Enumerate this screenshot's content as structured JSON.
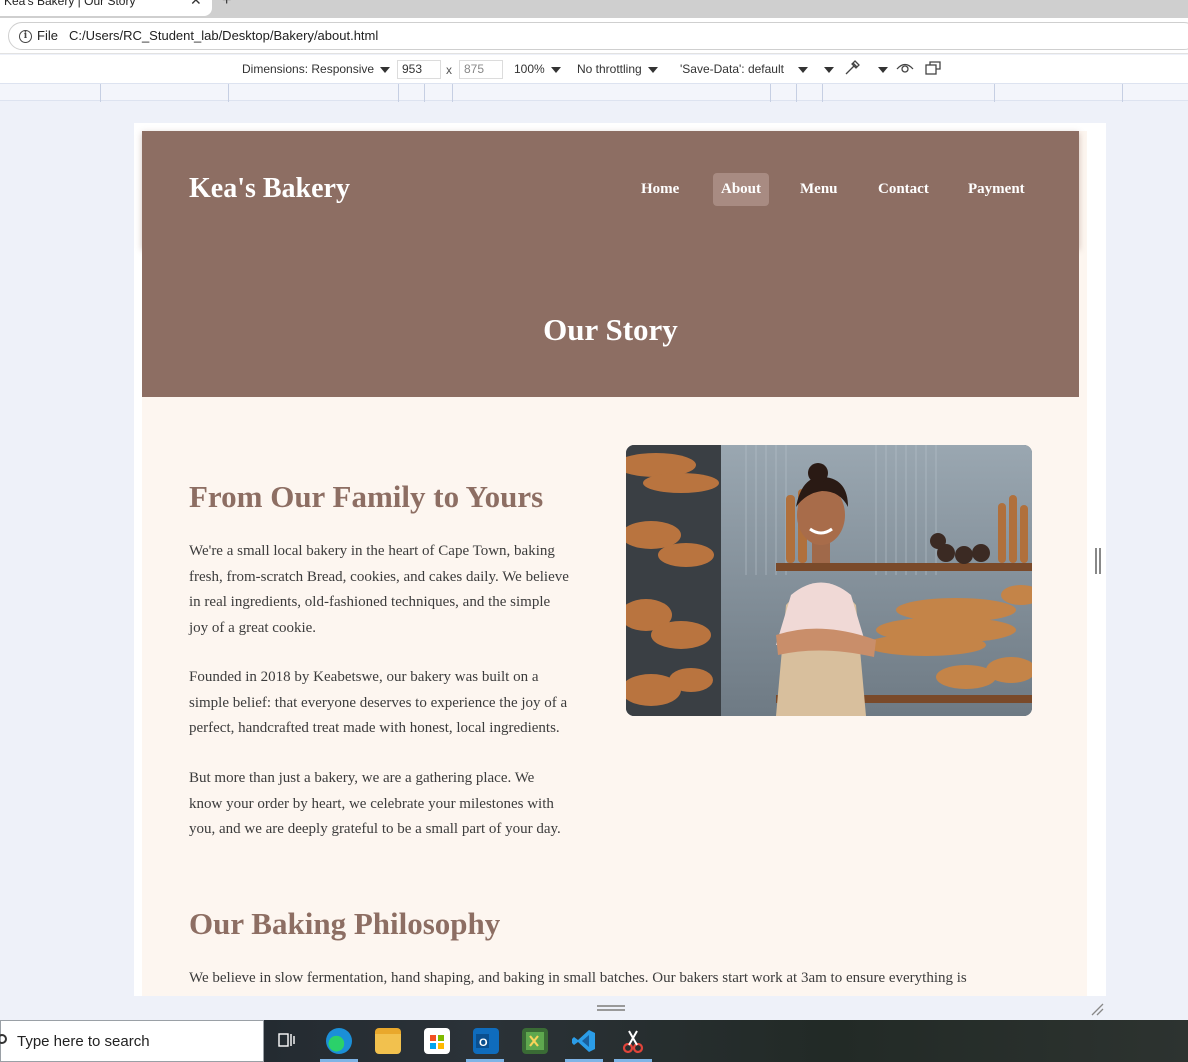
{
  "browser": {
    "tab_title": "Kea's Bakery | Our Story",
    "tab_close": "✕",
    "new_tab": "+",
    "file_label": "File",
    "url": "C:/Users/RC_Student_lab/Desktop/Bakery/about.html"
  },
  "devtools": {
    "dimensions_label": "Dimensions: Responsive",
    "width": "953",
    "x": "x",
    "height": "875",
    "zoom": "100%",
    "throttling": "No throttling",
    "save_data": "'Save-Data': default"
  },
  "site": {
    "logo": "Kea's Bakery",
    "nav": [
      {
        "label": "Home",
        "active": false
      },
      {
        "label": "About",
        "active": true
      },
      {
        "label": "Menu",
        "active": false
      },
      {
        "label": "Contact",
        "active": false
      },
      {
        "label": "Payment",
        "active": false
      }
    ],
    "hero_title": "Our Story",
    "section1": {
      "heading": "From Our Family to Yours",
      "p1_lines": [
        "We're a small local bakery in the heart of Cape Town, baking",
        "fresh, from-scratch Bread, cookies, and cakes daily. We believe",
        "in real ingredients, old-fashioned techniques, and the simple",
        "joy of a great cookie."
      ],
      "p2_lines": [
        "Founded in 2018 by Keabetswe, our bakery was built on a",
        "simple belief: that everyone deserves to experience the joy of a",
        "perfect, handcrafted treat made with honest, local ingredients."
      ],
      "p3_lines": [
        "But more than just a bakery, we are a gathering place. We",
        "know your order by heart, we celebrate your milestones with",
        "you, and we are deeply grateful to be a small part of your day."
      ]
    },
    "section2": {
      "heading": "Our Baking Philosophy",
      "p1": "We believe in slow fermentation, hand shaping, and baking in small batches. Our bakers start work at 3am to ensure everything is"
    }
  },
  "taskbar": {
    "search_placeholder": "Type here to search"
  },
  "colors": {
    "brand_brown": "#8d6e63",
    "page_cream": "#fdf6f0",
    "nav_active": "#a88b82"
  }
}
